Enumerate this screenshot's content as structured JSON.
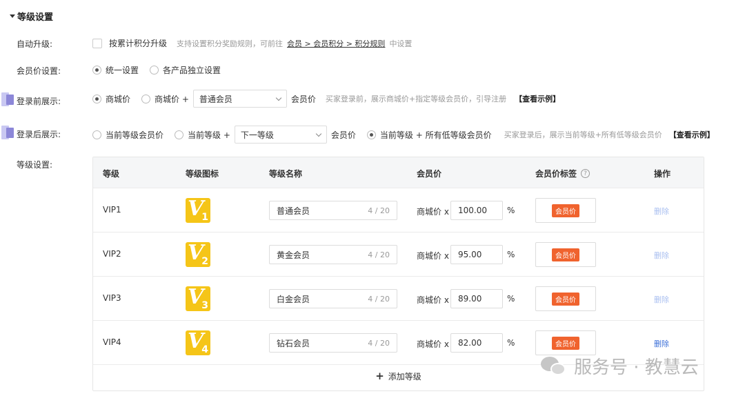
{
  "section_title": "等级设置",
  "auto_upgrade": {
    "label": "自动升级:",
    "checkbox_label": "按累计积分升级",
    "hint_prefix": "支持设置积分奖励规则，可前往",
    "hint_link": "会员 > 会员积分 > 积分规则",
    "hint_suffix": "中设置"
  },
  "member_price": {
    "label": "会员价设置:",
    "options": [
      "统一设置",
      "各产品独立设置"
    ],
    "selected": "统一设置"
  },
  "before_login": {
    "label": "登录前展示:",
    "opt1": "商城价",
    "opt2_prefix": "商城价 +",
    "select_value": "普通会员",
    "opt2_suffix": "会员价",
    "hint": "买家登录前，展示商城价+指定等级会员价，引导注册",
    "example": "【查看示例】"
  },
  "after_login": {
    "label": "登录后展示:",
    "opt1": "当前等级会员价",
    "opt2_prefix": "当前等级 +",
    "select_value": "下一等级",
    "opt2_suffix": "会员价",
    "opt3": "当前等级 + 所有低等级会员价",
    "hint": "买家登录后，展示当前等级+所有低等级会员价",
    "example": "【查看示例】"
  },
  "level_setting_label": "等级设置:",
  "table": {
    "headers": {
      "level": "等级",
      "icon": "等级图标",
      "name": "等级名称",
      "price": "会员价",
      "tag": "会员价标签",
      "ops": "操作"
    },
    "rows": [
      {
        "level": "VIP1",
        "icon_num": "1",
        "name": "普通会员",
        "count": "4 / 20",
        "price_prefix": "商城价 x",
        "price": "100.00",
        "unit": "%",
        "tag": "会员价",
        "op": "删除"
      },
      {
        "level": "VIP2",
        "icon_num": "2",
        "name": "黄金会员",
        "count": "4 / 20",
        "price_prefix": "商城价 x",
        "price": "95.00",
        "unit": "%",
        "tag": "会员价",
        "op": "删除"
      },
      {
        "level": "VIP3",
        "icon_num": "3",
        "name": "白金会员",
        "count": "4 / 20",
        "price_prefix": "商城价 x",
        "price": "89.00",
        "unit": "%",
        "tag": "会员价",
        "op": "删除"
      },
      {
        "level": "VIP4",
        "icon_num": "4",
        "name": "钻石会员",
        "count": "4 / 20",
        "price_prefix": "商城价 x",
        "price": "82.00",
        "unit": "%",
        "tag": "会员价",
        "op": "删除"
      }
    ],
    "add_label": "添加等级"
  },
  "watermark": "服务号 · 教慧云",
  "colors": {
    "tag_bg": "#f0632e",
    "icon_bg": "#f5c518",
    "delete_active": "#3b6fd8",
    "delete_disabled": "#a9bff0"
  }
}
